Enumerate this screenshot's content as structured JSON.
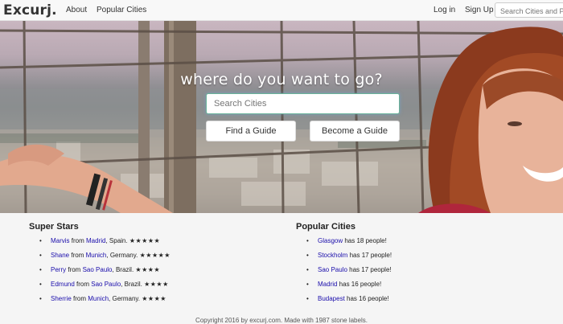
{
  "navbar": {
    "brand": "Excurj.",
    "links": [
      "About",
      "Popular Cities"
    ],
    "login": "Log in",
    "signup": "Sign Up",
    "search_placeholder": "Search Cities and People"
  },
  "hero": {
    "title": "where do you want to go?",
    "search_placeholder": "Search Cities",
    "find_button": "Find a Guide",
    "become_button": "Become a Guide"
  },
  "super_stars": {
    "heading": "Super Stars",
    "items": [
      {
        "name": "Marvis",
        "from": " from ",
        "city": "Madrid",
        "country": ", Spain. ",
        "stars": "★★★★★"
      },
      {
        "name": "Shane",
        "from": " from ",
        "city": "Munich",
        "country": ", Germany. ",
        "stars": "★★★★★"
      },
      {
        "name": "Perry",
        "from": " from ",
        "city": "Sao Paulo",
        "country": ", Brazil. ",
        "stars": "★★★★"
      },
      {
        "name": "Edmund",
        "from": " from ",
        "city": "Sao Paulo",
        "country": ", Brazil. ",
        "stars": "★★★★"
      },
      {
        "name": "Sherrie",
        "from": " from ",
        "city": "Munich",
        "country": ", Germany. ",
        "stars": "★★★★"
      }
    ]
  },
  "popular_cities": {
    "heading": "Popular Cities",
    "items": [
      {
        "city": "Glasgow",
        "text": " has 18 people!"
      },
      {
        "city": "Stockholm",
        "text": " has 17 people!"
      },
      {
        "city": "Sao Paulo",
        "text": " has 17 people!"
      },
      {
        "city": "Madrid",
        "text": " has 16 people!"
      },
      {
        "city": "Budapest",
        "text": " has 16 people!"
      }
    ]
  },
  "footer": {
    "text": "Copyright 2016 by excurj.com. Made with 1987 stone labels."
  },
  "colors": {
    "link": "#1a0dab",
    "input_focus": "#69b39a"
  }
}
